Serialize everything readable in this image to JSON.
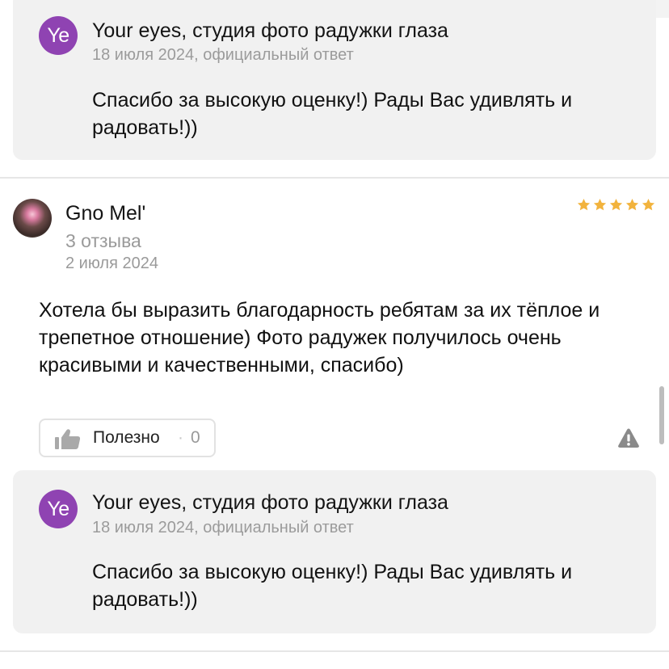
{
  "top_reply": {
    "avatar_initials": "Ye",
    "org_name": "Your eyes, студия фото радужки глаза",
    "meta": "18 июля 2024, официальный ответ",
    "text": "Спасибо за высокую оценку!) Рады Вас удивлять и радовать!))"
  },
  "review": {
    "author_name": "Gno Mel'",
    "author_reviews": "3 отзыва",
    "date": "2 июля 2024",
    "rating": 5,
    "rating_max": 5,
    "text": "Хотела бы выразить благодарность ребятам за их тёплое и трепетное отношение) Фото радужек получилось очень красивыми и качественными, спасибо)",
    "useful_label": "Полезно",
    "useful_separator": "·",
    "useful_count": "0"
  },
  "reply": {
    "avatar_initials": "Ye",
    "org_name": "Your eyes, студия фото радужки глаза",
    "meta": "18 июля 2024, официальный ответ",
    "text": "Спасибо за высокую оценку!) Рады Вас удивлять и радовать!))"
  },
  "colors": {
    "org_avatar": "#8f43b2",
    "star": "#f2b33d",
    "reply_background": "#f1f1f1",
    "accent_green": "#4e9a3e"
  },
  "icons": {
    "useful": "thumbs-up-icon",
    "report": "warning-icon",
    "rating": "star-icon"
  }
}
